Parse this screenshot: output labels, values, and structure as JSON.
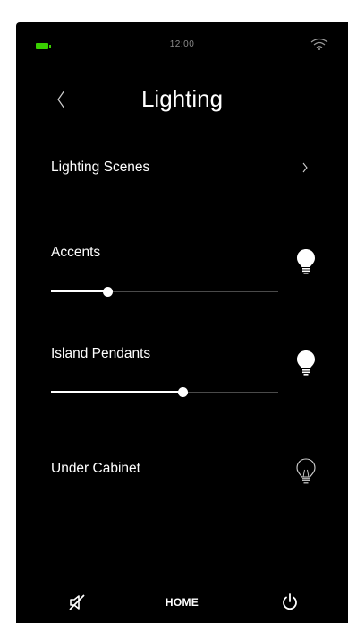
{
  "colors": {
    "background": "#000000",
    "accent_battery": "#39d000",
    "text": "#ffffff"
  },
  "status_bar": {
    "time": "12:00",
    "battery_icon": "battery-icon",
    "wifi_icon": "wifi-icon"
  },
  "header": {
    "title": "Lighting",
    "back_icon": "back-chevron-icon"
  },
  "menu": {
    "lighting_scenes": {
      "label": "Lighting Scenes",
      "icon": "chevron-right-icon"
    }
  },
  "lights": [
    {
      "label": "Accents",
      "level": 0.25,
      "state": "on",
      "icon": "bulb-on-icon"
    },
    {
      "label": "Island Pendants",
      "level": 0.58,
      "state": "on",
      "icon": "bulb-on-icon"
    },
    {
      "label": "Under Cabinet",
      "state": "off",
      "icon": "bulb-off-icon"
    }
  ],
  "tabbar": {
    "left_icon": "mute-icon",
    "home_label": "HOME",
    "right_icon": "power-icon"
  }
}
